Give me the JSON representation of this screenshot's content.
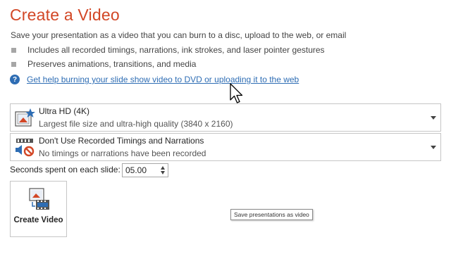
{
  "page": {
    "title": "Create a Video",
    "description": "Save your presentation as a video that you can burn to a disc, upload to the web, or email",
    "bullets": [
      "Includes all recorded timings, narrations, ink strokes, and laser pointer gestures",
      "Preserves animations, transitions, and media"
    ],
    "help_link": "Get help burning your slide show video to DVD or uploading it to the web"
  },
  "quality_dropdown": {
    "label": "Ultra HD (4K)",
    "sublabel": "Largest file size and ultra-high quality (3840 x 2160)",
    "icon": "ultra-hd-star-icon"
  },
  "timings_dropdown": {
    "label": "Don't Use Recorded Timings and Narrations",
    "sublabel": "No timings or narrations have been recorded",
    "icon": "timings-narrations-icon"
  },
  "seconds": {
    "label": "Seconds spent on each slide:",
    "value": "05.00"
  },
  "create_button": {
    "label": "Create Video",
    "tooltip": "Save presentations as video"
  },
  "colors": {
    "title": "#d24726",
    "link": "#2e6db4"
  }
}
